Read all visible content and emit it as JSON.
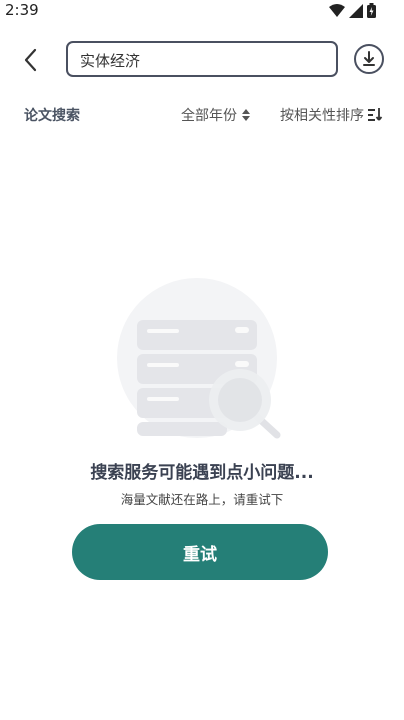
{
  "status_bar": {
    "time": "2:39",
    "icons": [
      "wifi-icon",
      "signal-icon",
      "battery-icon"
    ]
  },
  "header": {
    "search_value": "实体经济",
    "back_icon": "back-icon",
    "download_icon": "download-icon"
  },
  "filters": {
    "title": "论文搜索",
    "year": "全部年份",
    "sort": "按相关性排序"
  },
  "error": {
    "title": "搜索服务可能遇到点小问题...",
    "subtitle": "海量文献还在路上，请重试下",
    "retry_label": "重试"
  },
  "colors": {
    "accent": "#257f77",
    "border": "#4a5060",
    "muted_text": "#4b5463"
  }
}
